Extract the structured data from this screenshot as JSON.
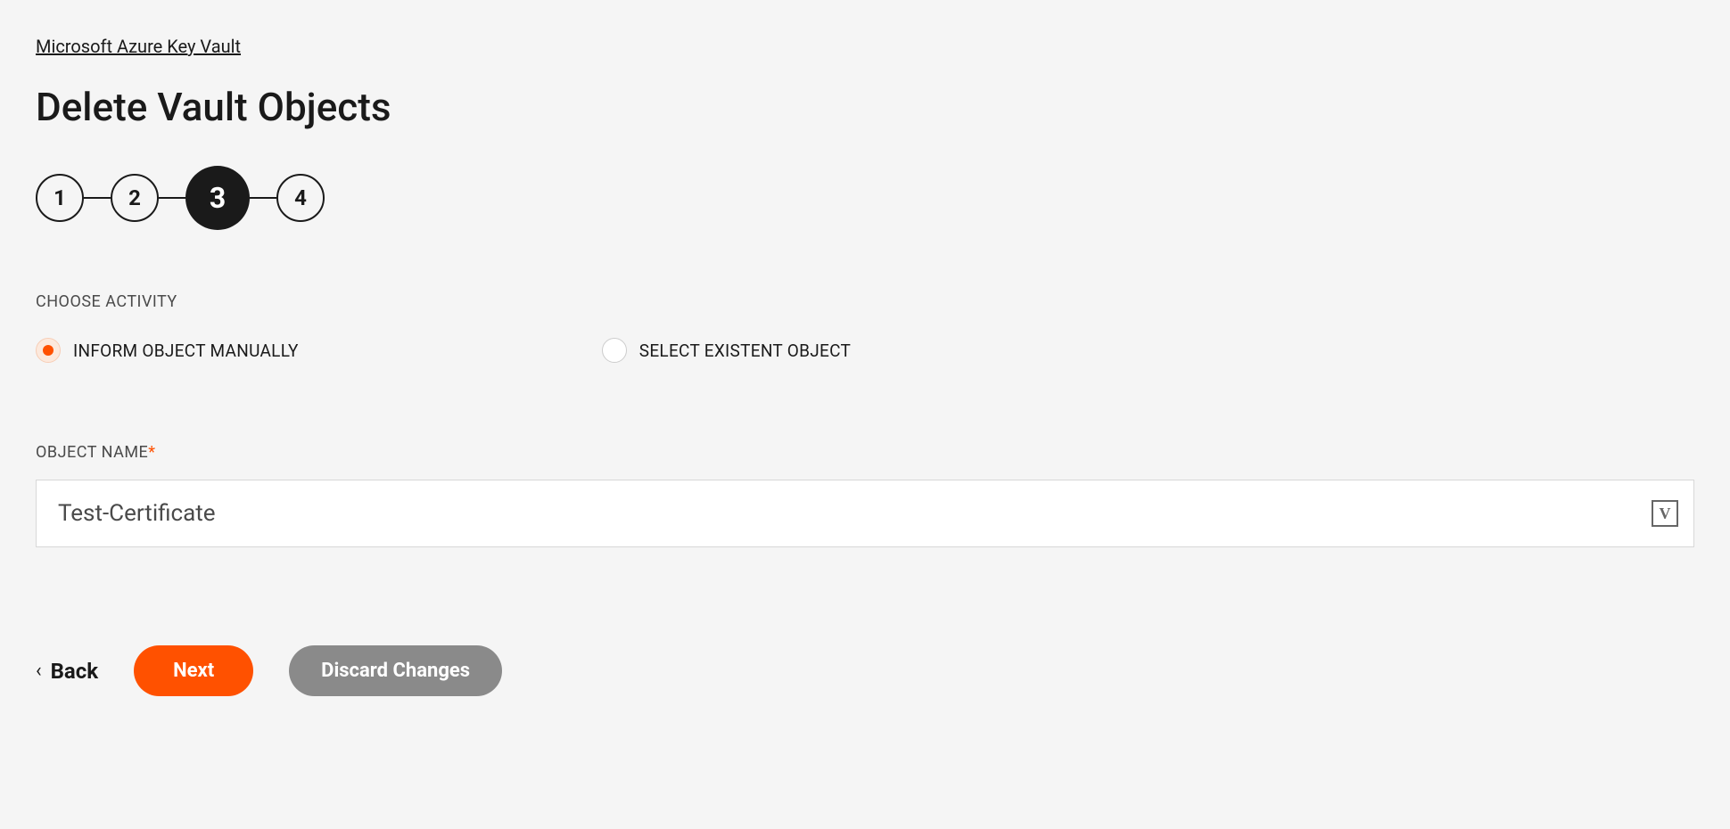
{
  "breadcrumb": {
    "label": "Microsoft Azure Key Vault"
  },
  "header": {
    "title": "Delete Vault Objects"
  },
  "stepper": {
    "steps": [
      "1",
      "2",
      "3",
      "4"
    ],
    "activeIndex": 2
  },
  "activitySection": {
    "label": "CHOOSE ACTIVITY",
    "options": [
      {
        "label": "INFORM OBJECT MANUALLY",
        "selected": true
      },
      {
        "label": "SELECT EXISTENT OBJECT",
        "selected": false
      }
    ]
  },
  "objectNameField": {
    "label": "OBJECT NAME",
    "required": true,
    "value": "Test-Certificate",
    "suffixIconLabel": "V"
  },
  "actions": {
    "back": "Back",
    "next": "Next",
    "discard": "Discard Changes"
  },
  "colors": {
    "accent": "#ff5100",
    "muted": "#8a8a8a"
  }
}
